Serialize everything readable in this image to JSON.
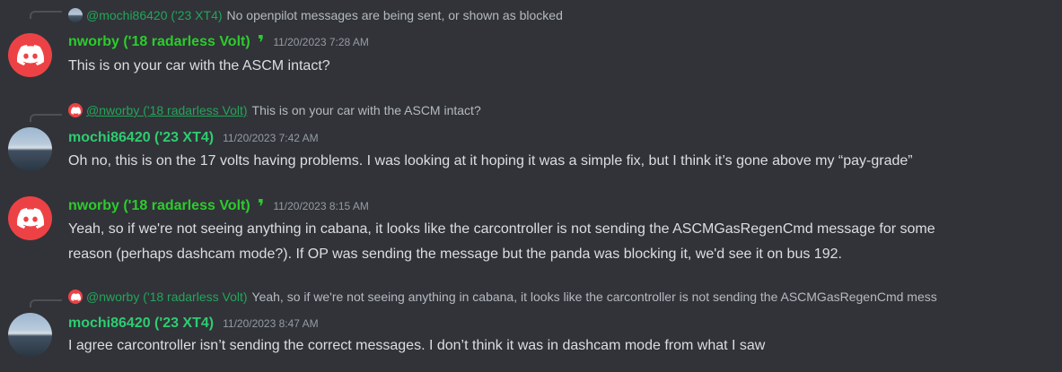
{
  "messages": [
    {
      "reply": {
        "author": "@mochi86420 ('23 XT4)",
        "text": "No openpilot messages are being sent, or shown as blocked",
        "avatar": "photo-avatar"
      },
      "author": "nworby ('18 radarless Volt)",
      "badge": "❜",
      "timestamp": "11/20/2023 7:28 AM",
      "text": "This is on your car with the ASCM intact?",
      "avatar": "discord-avatar"
    },
    {
      "reply": {
        "author": "@nworby ('18 radarless Volt)",
        "text": "This is on your car with the ASCM intact?",
        "avatar": "discord-avatar"
      },
      "author": "mochi86420 ('23 XT4)",
      "timestamp": "11/20/2023 7:42 AM",
      "text": "Oh no, this is on the 17 volts having problems. I was looking at it hoping it was a simple fix, but I think it’s gone above my “pay-grade”",
      "avatar": "photo-avatar"
    },
    {
      "author": "nworby ('18 radarless Volt)",
      "badge": "❜",
      "timestamp": "11/20/2023 8:15 AM",
      "text_line1": "Yeah, so if we're not seeing anything in cabana, it looks like the carcontroller is not sending the ASCMGasRegenCmd message for some",
      "text_line2": "reason (perhaps dashcam mode?). If OP was sending the message but the panda was blocking it, we'd see it on bus 192.",
      "avatar": "discord-avatar"
    },
    {
      "reply": {
        "author": "@nworby ('18 radarless Volt)",
        "text": "Yeah, so if we're not seeing anything in cabana, it looks like the carcontroller is not sending the ASCMGasRegenCmd mess",
        "avatar": "discord-avatar"
      },
      "author": "mochi86420 ('23 XT4)",
      "timestamp": "11/20/2023 8:47 AM",
      "text": "I agree carcontroller isn’t sending the correct messages. I don’t think it was in dashcam mode from what I saw",
      "avatar": "photo-avatar"
    }
  ],
  "colors": {
    "background": "#313338",
    "text": "#dbdee1",
    "muted": "#949ba4",
    "author_green": "#2ecc71",
    "discord_red": "#ed4245"
  }
}
